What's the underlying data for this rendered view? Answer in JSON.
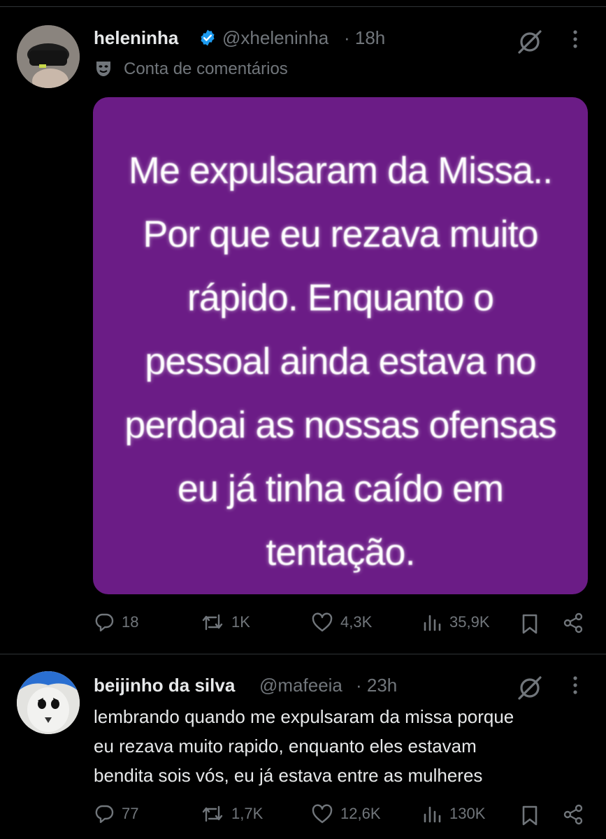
{
  "post1": {
    "name": "heleninha",
    "handle": "@xheleninha",
    "time": "· 18h",
    "label": "Conta de comentários",
    "image_text_lines": [
      "Me expulsaram da Missa..",
      "Por que eu rezava muito",
      "rápido. Enquanto o",
      "pessoal ainda estava no",
      "perdoai as nossas ofensas",
      "eu já tinha caído em",
      "tentação."
    ],
    "actions": {
      "replies": "18",
      "reposts": "1K",
      "likes": "4,3K",
      "views": "35,9K"
    }
  },
  "post2": {
    "name": "beijinho da silva",
    "handle": "@mafeeia",
    "time": "· 23h",
    "text_lines": [
      "lembrando quando me expulsaram da missa porque",
      "eu rezava muito rapido, enquanto eles estavam",
      "bendita sois vós, eu já estava entre as mulheres"
    ],
    "actions": {
      "replies": "77",
      "reposts": "1,7K",
      "likes": "12,6K",
      "views": "130K"
    }
  },
  "icons": {
    "verified": "verified-badge-icon",
    "grok": "grok-icon",
    "more": "more-dots-icon",
    "label": "theater-mask-icon",
    "reply": "reply-icon",
    "repost": "repost-icon",
    "like": "heart-icon",
    "views": "views-chart-icon",
    "bookmark": "bookmark-icon",
    "share": "share-icon"
  },
  "colors": {
    "background": "#000000",
    "text": "#e7e9ea",
    "muted": "#71767b",
    "media": "#6b1c86",
    "verified": "#1d9bf0"
  }
}
